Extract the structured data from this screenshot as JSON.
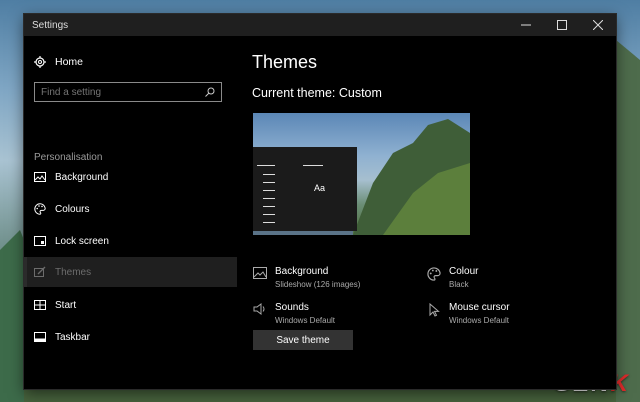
{
  "window": {
    "title": "Settings"
  },
  "sidebar": {
    "home_label": "Home",
    "search_placeholder": "Find a setting",
    "section_label": "Personalisation",
    "items": [
      {
        "label": "Background",
        "icon": "picture-icon"
      },
      {
        "label": "Colours",
        "icon": "palette-icon"
      },
      {
        "label": "Lock screen",
        "icon": "lock-screen-icon"
      },
      {
        "label": "Themes",
        "icon": "brush-icon",
        "selected": true
      },
      {
        "label": "Start",
        "icon": "start-icon"
      },
      {
        "label": "Taskbar",
        "icon": "taskbar-icon"
      }
    ]
  },
  "main": {
    "title": "Themes",
    "current_theme": "Current theme: Custom",
    "preview_sample": "Aa",
    "options": [
      {
        "label": "Background",
        "value": "Slideshow (126 images)",
        "icon": "picture-icon"
      },
      {
        "label": "Colour",
        "value": "Black",
        "icon": "palette-icon"
      },
      {
        "label": "Sounds",
        "value": "Windows Default",
        "icon": "speaker-icon"
      },
      {
        "label": "Mouse cursor",
        "value": "Windows Default",
        "icon": "cursor-icon"
      }
    ],
    "save_button": "Save theme"
  },
  "watermark": {
    "text_1": "GEN",
    "text_2": "K"
  }
}
